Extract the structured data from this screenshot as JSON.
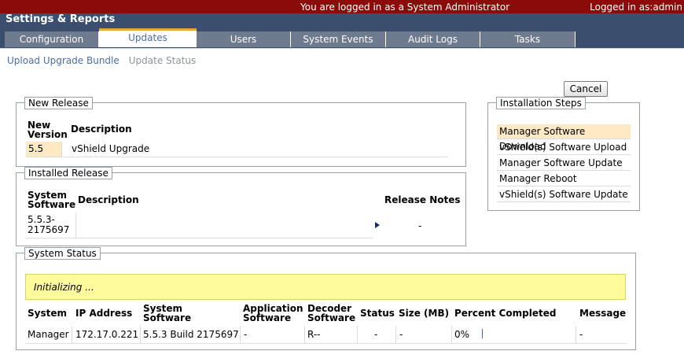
{
  "header": {
    "app_title": "Settings & Reports",
    "login_message": "You are logged in as a System Administrator",
    "logged_in_as": "Logged in as:admin"
  },
  "tabs": [
    {
      "label": "Configuration",
      "active": false
    },
    {
      "label": "Updates",
      "active": true
    },
    {
      "label": "Users",
      "active": false
    },
    {
      "label": "System Events",
      "active": false
    },
    {
      "label": "Audit Logs",
      "active": false
    },
    {
      "label": "Tasks",
      "active": false
    }
  ],
  "subnav": {
    "upload": "Upload Upgrade Bundle",
    "status": "Update Status"
  },
  "cancel_label": "Cancel",
  "new_release": {
    "legend": "New Release",
    "col_version": "New Version",
    "col_description": "Description",
    "version": "5.5",
    "description": "vShield Upgrade"
  },
  "installed_release": {
    "legend": "Installed Release",
    "col_software": "System Software",
    "col_description": "Description",
    "col_notes": "Release Notes",
    "software": "5.5.3-2175697",
    "description": "",
    "notes": "-"
  },
  "installation_steps": {
    "legend": "Installation Steps",
    "items": [
      "Manager Software Download",
      "vShield(s) Software Upload",
      "Manager Software Update",
      "Manager Reboot",
      "vShield(s) Software Update"
    ],
    "active_index": 0
  },
  "system_status": {
    "legend": "System Status",
    "banner": "Initializing ...",
    "columns": [
      "System",
      "IP Address",
      "System Software",
      "Application Software",
      "Decoder Software",
      "Status",
      "Size (MB)",
      "Percent Completed",
      "Message"
    ],
    "row": {
      "system": "Manager",
      "ip": "172.17.0.221",
      "software": "5.5.3 Build 2175697",
      "app_software": "-",
      "decoder": "R--",
      "status": "-",
      "size": "-",
      "percent": "0%",
      "message": "-"
    }
  },
  "colors": {
    "topbar": "#8b0a0a",
    "titlebar": "#3b4e6e",
    "banner": "#fdfb9c",
    "active_step": "#fde9c3",
    "tab_accent": "#e8a73c"
  }
}
